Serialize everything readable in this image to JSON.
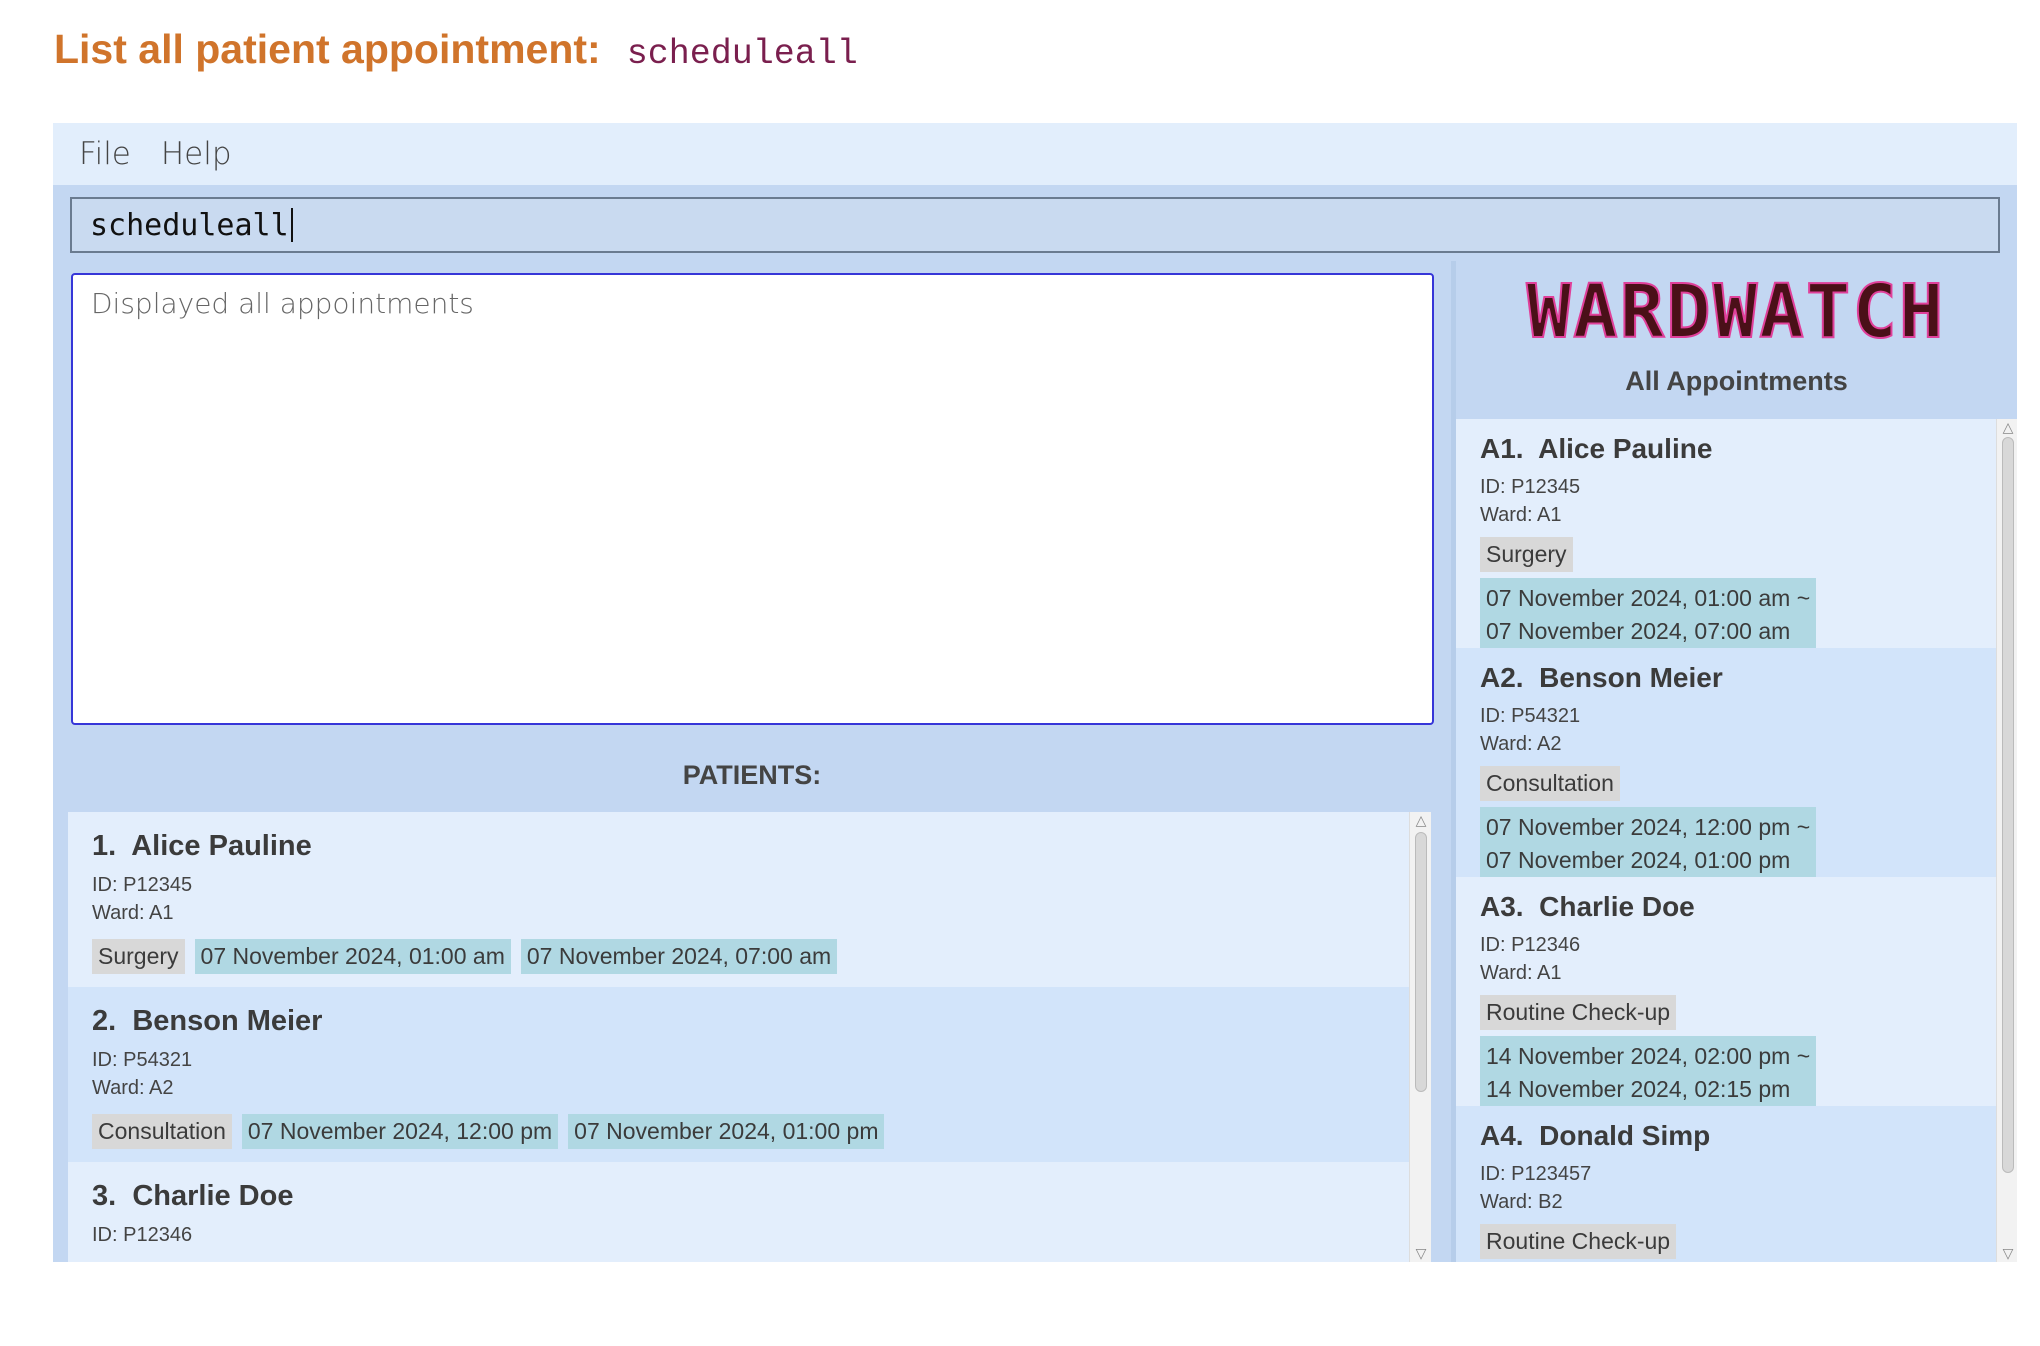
{
  "doc_heading": {
    "title": "List all patient appointment:",
    "command": "scheduleall"
  },
  "menubar": {
    "items": [
      "File",
      "Help"
    ]
  },
  "command_box": {
    "value": "scheduleall"
  },
  "result_display": {
    "text": "Displayed all appointments"
  },
  "patients_panel": {
    "header": "PATIENTS:",
    "patients": [
      {
        "index": "1.",
        "name": "Alice Pauline",
        "id": "ID: P12345",
        "ward": "Ward: A1",
        "appointment_type": "Surgery",
        "start": "07 November 2024, 01:00 am",
        "end": "07 November 2024, 07:00 am"
      },
      {
        "index": "2.",
        "name": "Benson Meier",
        "id": "ID: P54321",
        "ward": "Ward: A2",
        "appointment_type": "Consultation",
        "start": "07 November 2024, 12:00 pm",
        "end": "07 November 2024, 01:00 pm"
      },
      {
        "index": "3.",
        "name": "Charlie Doe",
        "id": "ID: P12346",
        "ward": "",
        "appointment_type": "",
        "start": "",
        "end": ""
      }
    ]
  },
  "appointments_panel": {
    "logo_text": "WARDWATCH",
    "header": "All Appointments",
    "appointments": [
      {
        "index": "A1.",
        "name": "Alice Pauline",
        "id": "ID: P12345",
        "ward": "Ward: A1",
        "appointment_type": "Surgery",
        "time_line1": "07 November 2024, 01:00 am ~",
        "time_line2": "07 November 2024, 07:00 am"
      },
      {
        "index": "A2.",
        "name": "Benson Meier",
        "id": "ID: P54321",
        "ward": "Ward: A2",
        "appointment_type": "Consultation",
        "time_line1": "07 November 2024, 12:00 pm ~",
        "time_line2": "07 November 2024, 01:00 pm"
      },
      {
        "index": "A3.",
        "name": "Charlie Doe",
        "id": "ID: P12346",
        "ward": "Ward: A1",
        "appointment_type": "Routine Check-up",
        "time_line1": "14 November 2024, 02:00 pm ~",
        "time_line2": "14 November 2024, 02:15 pm"
      },
      {
        "index": "A4.",
        "name": "Donald Simp",
        "id": "ID: P123457",
        "ward": "Ward: B2",
        "appointment_type": "Routine Check-up",
        "time_line1": "",
        "time_line2": ""
      }
    ]
  },
  "colors": {
    "heading": "#d0742b",
    "command_code": "#7a1f4e",
    "app_background": "#c3d7f2",
    "card_light": "#e3eefc",
    "card_dark": "#d2e4fa",
    "type_tag": "#d8d8d8",
    "time_tag": "#b0d8e3",
    "result_border": "#3636d8",
    "logo_fill": "#4a1018",
    "logo_outline": "#e0409a"
  }
}
